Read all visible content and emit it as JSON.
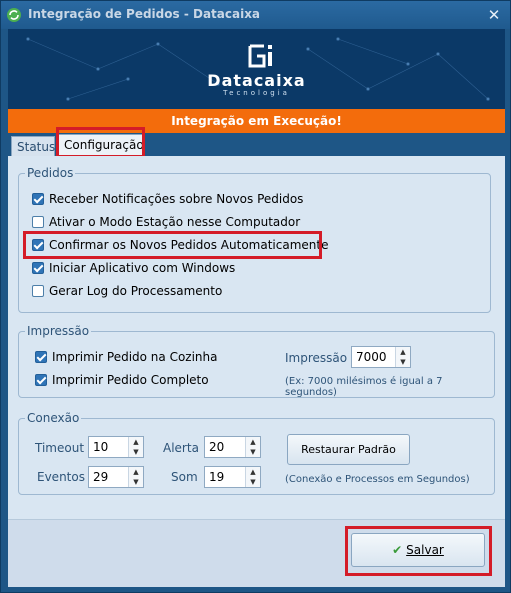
{
  "window": {
    "title": "Integração de Pedidos - Datacaixa",
    "close_glyph": "✕"
  },
  "brand": {
    "name": "Datacaixa",
    "subtitle": "Tecnologia"
  },
  "status": {
    "text": "Integração em Execução!",
    "color": "#f36c0c"
  },
  "tabs": [
    {
      "label": "Status",
      "active": false
    },
    {
      "label": "Configuração",
      "active": true
    }
  ],
  "pedidos": {
    "title": "Pedidos",
    "options": [
      {
        "label": "Receber Notificações sobre Novos Pedidos",
        "checked": true
      },
      {
        "label": "Ativar o Modo Estação nesse Computador",
        "checked": false
      },
      {
        "label": "Confirmar os Novos Pedidos Automaticamente",
        "checked": true
      },
      {
        "label": "Iniciar Aplicativo com Windows",
        "checked": true
      },
      {
        "label": "Gerar Log do Processamento",
        "checked": false
      }
    ]
  },
  "impressao": {
    "title": "Impressão",
    "options": [
      {
        "label": "Imprimir Pedido na Cozinha",
        "checked": true
      },
      {
        "label": "Imprimir Pedido Completo",
        "checked": true
      }
    ],
    "field_label": "Impressão",
    "field_value": "7000",
    "hint": "(Ex: 7000 milésimos é igual a 7 segundos)"
  },
  "conexao": {
    "title": "Conexão",
    "timeout_label": "Timeout",
    "timeout_value": "10",
    "alerta_label": "Alerta",
    "alerta_value": "20",
    "eventos_label": "Eventos",
    "eventos_value": "29",
    "som_label": "Som",
    "som_value": "19",
    "restore_label": "Restaurar Padrão",
    "hint": "(Conexão e Processos em Segundos)"
  },
  "footer": {
    "save_label": "Salvar",
    "save_icon": "checkmark-icon"
  },
  "colors": {
    "accent": "#f36c0c",
    "highlight": "#d41c28",
    "window": "#1e5686"
  }
}
